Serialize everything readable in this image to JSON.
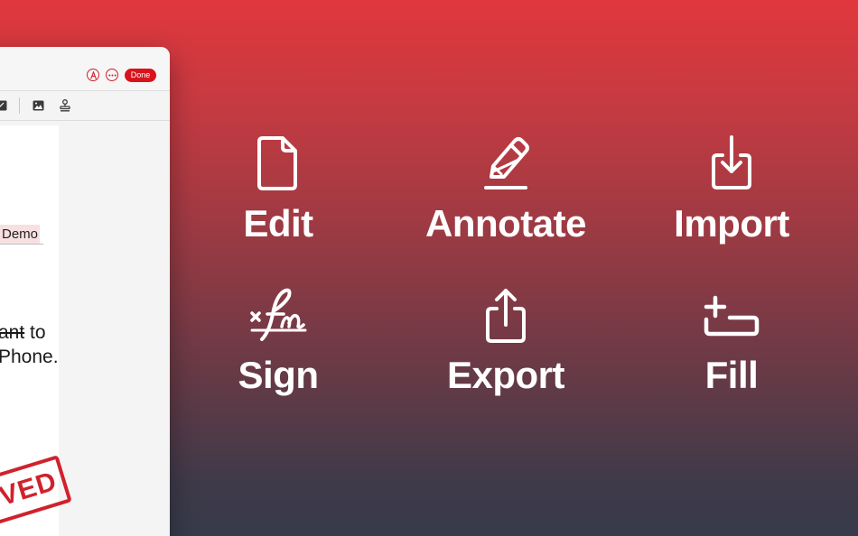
{
  "window": {
    "done_label": "Done",
    "controls": [
      "pen-circle-icon",
      "more-icon"
    ],
    "toolbar_icons": [
      "signature-box-icon",
      "image-icon",
      "stamp-icon"
    ]
  },
  "document": {
    "highlight_text": "Demo",
    "line1_strike": "ant",
    "line1_rest": " to",
    "line2": "Phone.",
    "stamp_text": "VED"
  },
  "features": {
    "edit": {
      "label": "Edit",
      "icon": "document-icon"
    },
    "annotate": {
      "label": "Annotate",
      "icon": "pencil-icon"
    },
    "import": {
      "label": "Import",
      "icon": "import-icon"
    },
    "sign": {
      "label": "Sign",
      "icon": "signature-icon"
    },
    "export": {
      "label": "Export",
      "icon": "share-icon"
    },
    "fill": {
      "label": "Fill",
      "icon": "form-fill-icon"
    }
  },
  "colors": {
    "accent": "#d7141d",
    "gradient_top": "#e0373d",
    "gradient_bottom": "#373b4b"
  }
}
